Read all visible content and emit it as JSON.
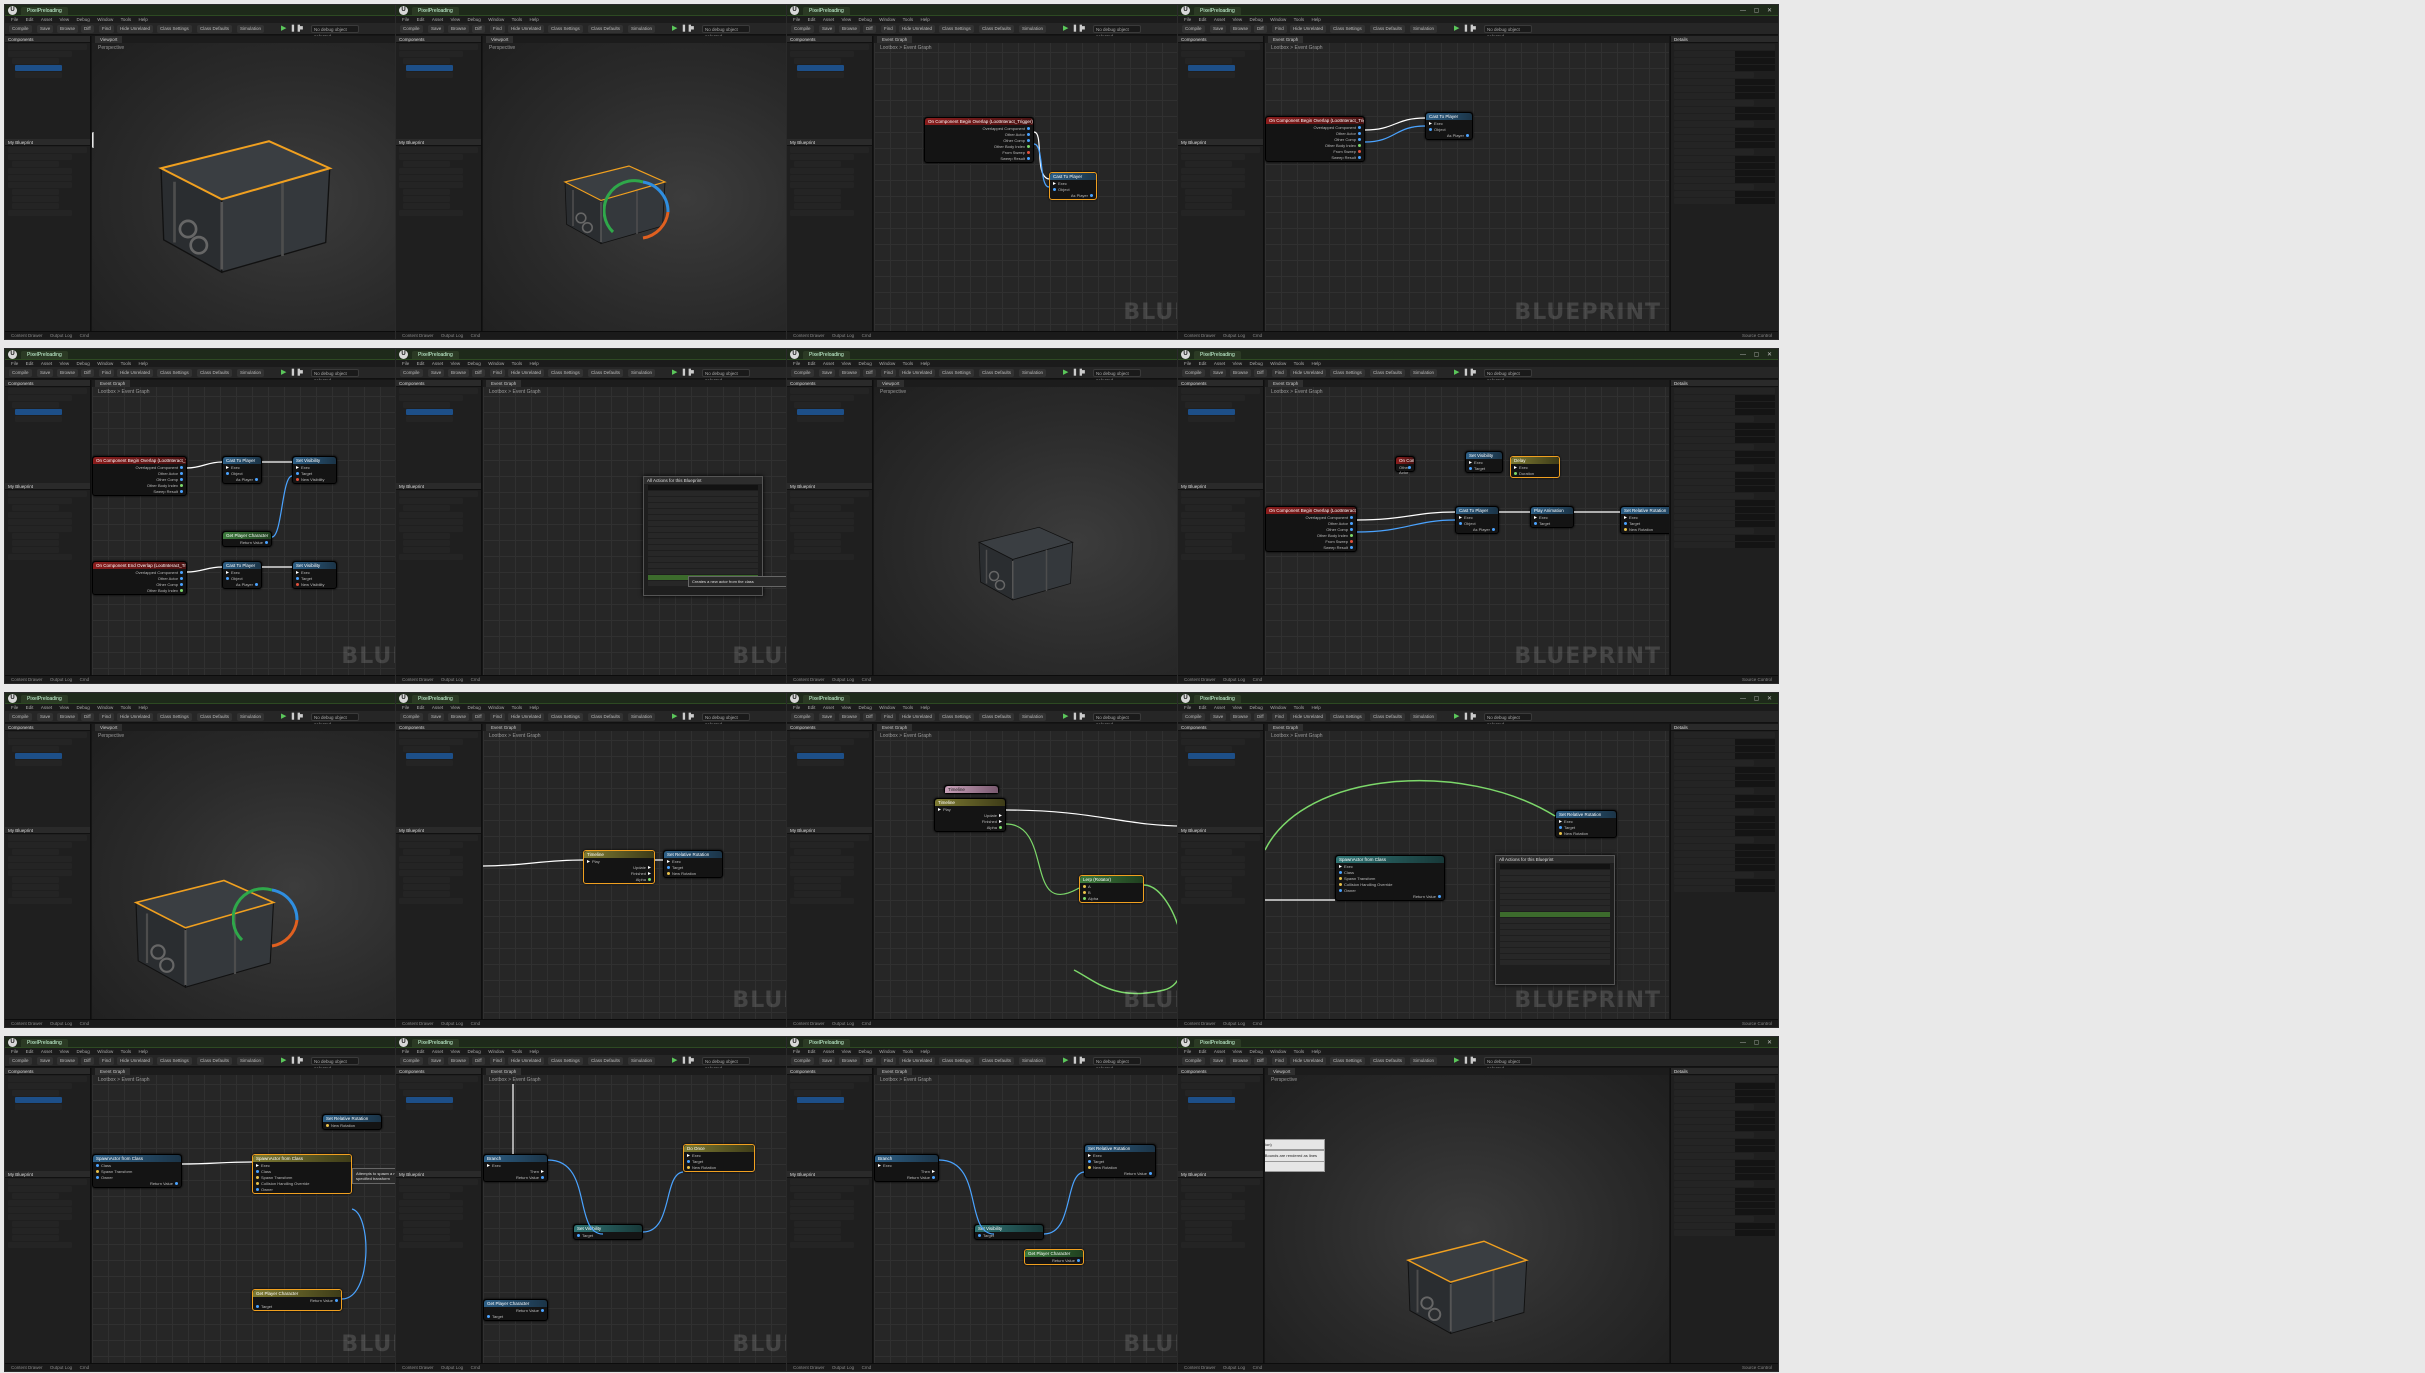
{
  "app": {
    "tab_label": "PixelPreloading",
    "window_buttons": "— ▢ ✕",
    "menu": [
      "File",
      "Edit",
      "Asset",
      "View",
      "Debug",
      "Window",
      "Tools",
      "Help"
    ],
    "toolbar": {
      "compile": "Compile",
      "save": "Save",
      "browse": "Browse",
      "diff": "Diff",
      "find": "Find",
      "hide_unrelated": "Hide Unrelated",
      "class_settings": "Class Settings",
      "class_defaults": "Class Defaults",
      "simulation": "Simulation",
      "debug_dropdown": "No debug object selected"
    },
    "status_bar": {
      "content_drawer": "Content Drawer",
      "output_log": "Output Log",
      "cmd": "Cmd",
      "source_control": "Source Control"
    }
  },
  "panels": {
    "components_title": "Components",
    "details_title": "Details",
    "my_blueprint_title": "My Blueprint",
    "components": [
      "Lootbox (Self)",
      "DefaultSceneRoot",
      "LootInteract_Trigger",
      "Lootbox_SM",
      "Lootbox_SM"
    ],
    "my_blueprint_sections": [
      "Graphs",
      "EventGraph",
      "Functions",
      "Macros",
      "Variables",
      "Components",
      "Event Dispatchers"
    ]
  },
  "graph": {
    "tab_label": "Event Graph",
    "breadcrumb": "Lootbox > Event Graph",
    "watermark": "BLUEPRINT",
    "viewport_tab": "Viewport",
    "viewport_mode": "Perspective"
  },
  "nodes": {
    "begin_overlap": "On Component Begin Overlap (LootInteract_Trigger)",
    "end_overlap": "On Component End Overlap (LootInteract_Trigger)",
    "cast": "Cast To Player",
    "set_visibility": "Set Visibility",
    "play_anim": "Play Animation",
    "timeline": "Timeline",
    "lerp": "Lerp (Rotator)",
    "set_rotation": "Set Relative Rotation",
    "spawn_actor": "SpawnActor from Class",
    "get_player": "Get Player Character",
    "branch": "Branch",
    "do_once": "Do Once",
    "delay": "Delay",
    "target": "Target",
    "new_rotation": "New Rotation",
    "return_value": "Return Value",
    "other_actor": "Other Actor",
    "overlapped_component": "Overlapped Component",
    "other_comp": "Other Comp",
    "other_body_index": "Other Body Index",
    "from_sweep": "From Sweep",
    "sweep_result": "Sweep Result",
    "exec_in": "Exec",
    "then": "Then",
    "play": "Play",
    "update": "Update",
    "finished": "Finished",
    "alpha": "Alpha",
    "a": "A",
    "b": "B",
    "class": "Class",
    "spawn_transform": "Spawn Transform",
    "collision_handling": "Collision Handling Override",
    "owner": "Owner",
    "object": "Object",
    "cast_failed": "Cast Failed",
    "as_player": "As Player",
    "new_visibility": "New Visibility",
    "propagate": "Propagate to Children",
    "duration": "Duration"
  },
  "popups": {
    "actions_title": "All Actions for this Blueprint",
    "context_sensitive": "Context Sensitive",
    "search_placeholder": "Search",
    "actions_tooltip": "Creates a new actor from the class"
  },
  "tooltips": {
    "viewport_hint": "Drag asset here to add a component",
    "trigger_title": "LootInteract_Trigger (Box Collision)",
    "trigger_details": "A box used for simple collision. Bounds are rendered as lines in the editor.",
    "trigger_native": "Native: Box Collision",
    "spawn_hint": "Attempts to spawn a new actor with the specified transform"
  },
  "colors": {
    "accent_green": "#2d4a22",
    "event_red": "#8a1c1c",
    "function_blue": "#2d5f86",
    "pure_green": "#3c7a3c",
    "selection_orange": "#f0a020",
    "exec_wire": "#ffffff",
    "object_wire": "#4aa3ff",
    "bool_wire": "#7cd86a"
  }
}
